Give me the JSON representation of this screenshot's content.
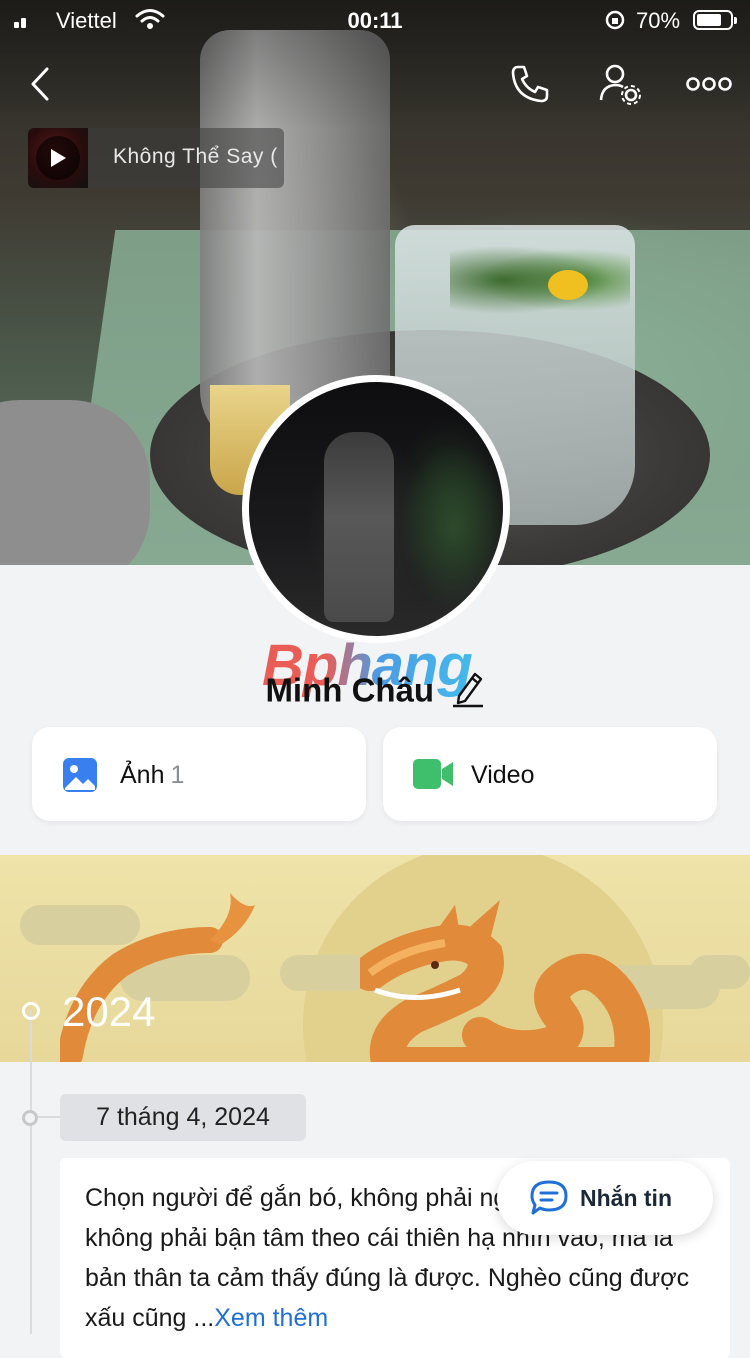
{
  "status_bar": {
    "carrier": "Viettel",
    "time": "00:11",
    "battery": "70%"
  },
  "music": {
    "song_title": "Không Thể Say ("
  },
  "watermark": "Bphang",
  "profile": {
    "name": "Minh Châu"
  },
  "media": {
    "photos_label": "Ảnh",
    "photos_count": "1",
    "video_label": "Video"
  },
  "timeline": {
    "year": "2024",
    "date": "7 tháng 4, 2024",
    "post_text": "Chọn người để gắn bó, không phải người khác nói, không phải bận tâm theo cái thiên hạ nhìn vào, mà là bản thân ta cảm thấy đúng là được. Nghèo cũng được xấu cũng ...",
    "see_more": "Xem thêm"
  },
  "message_button": {
    "label": "Nhắn tin"
  },
  "colors": {
    "accent": "#1f6fd6",
    "photo_icon": "#3a7ff0",
    "video_icon": "#3fbf6b"
  },
  "icons": [
    "back-icon",
    "phone-icon",
    "user-settings-icon",
    "more-icon",
    "play-icon",
    "edit-icon",
    "image-icon",
    "video-camera-icon",
    "chat-icon"
  ]
}
